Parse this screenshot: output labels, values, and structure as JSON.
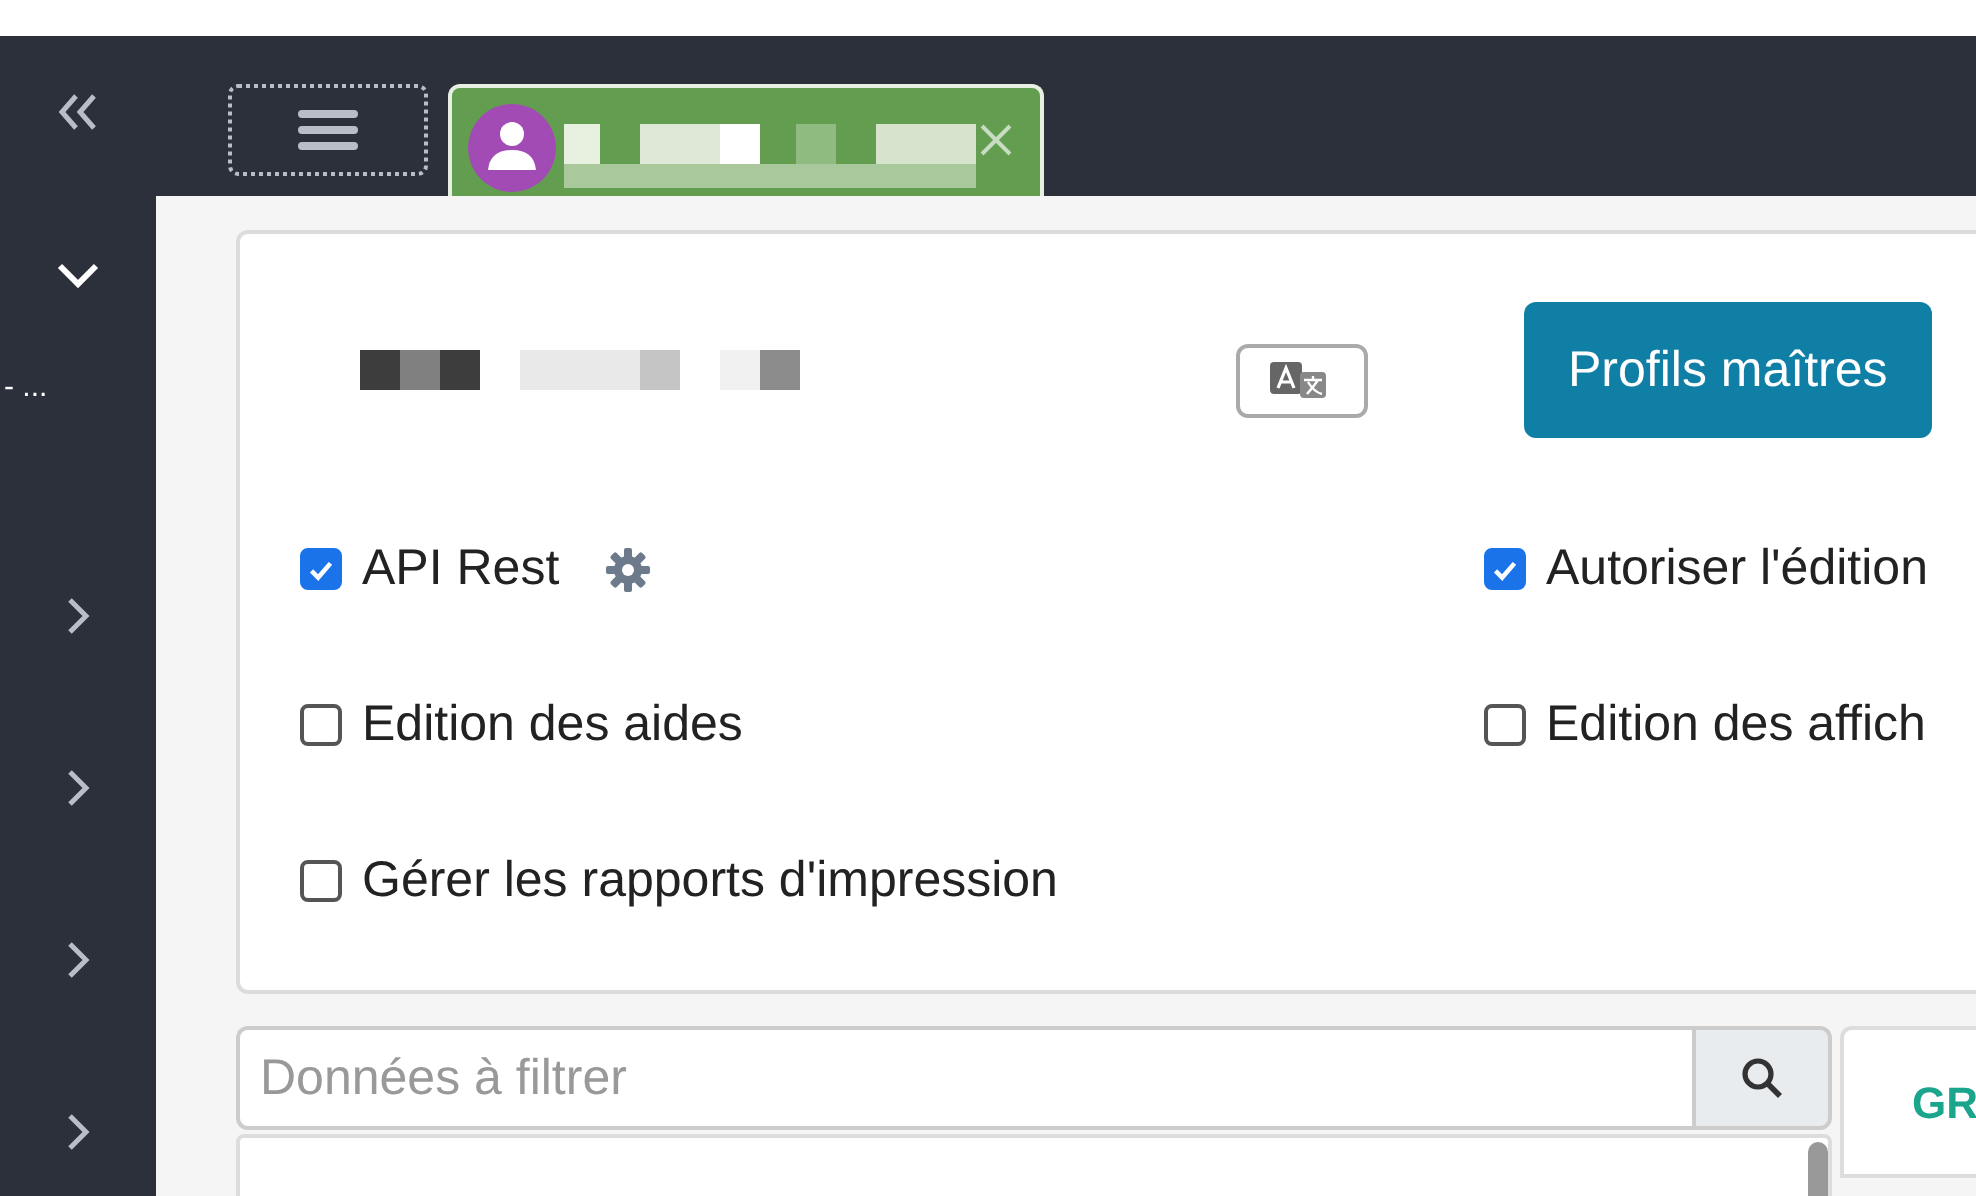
{
  "sidebar": {
    "items": [
      {
        "kind": "collapse"
      },
      {
        "kind": "expanded"
      },
      {
        "kind": "label",
        "text": "- ..."
      },
      {
        "kind": "collapsed"
      },
      {
        "kind": "collapsed"
      },
      {
        "kind": "collapsed"
      },
      {
        "kind": "collapsed"
      }
    ]
  },
  "tabs": [
    {
      "kind": "menu",
      "selected": false
    },
    {
      "kind": "user",
      "selected": true
    }
  ],
  "card": {
    "button": "Profils maîtres",
    "options": [
      {
        "label": "API Rest",
        "checked": true,
        "settings": true
      },
      {
        "label": "Autoriser l'édition",
        "checked": true,
        "settings": false
      },
      {
        "label": "Edition des aides",
        "checked": false,
        "settings": false
      },
      {
        "label": "Edition des affich",
        "checked": false,
        "settings": false
      },
      {
        "label": "Gérer les rapports d'impression",
        "checked": false,
        "settings": false
      }
    ]
  },
  "filter": {
    "placeholder": "Données à filtrer"
  },
  "side_tab": {
    "label": "GR"
  }
}
